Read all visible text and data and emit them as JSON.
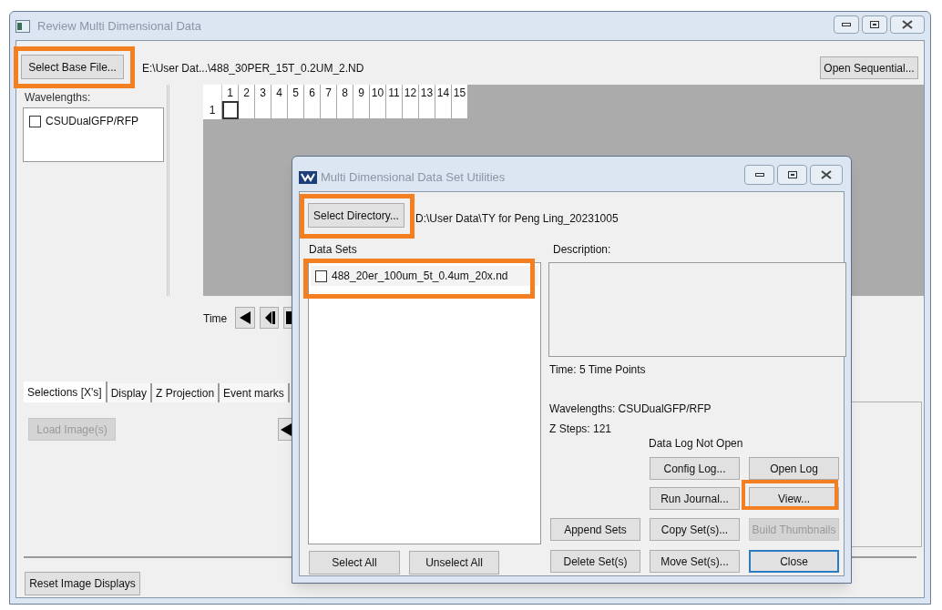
{
  "main_window": {
    "title": "Review Multi Dimensional Data",
    "base_file_button": {
      "label": "Select Base File...",
      "highlighted": true
    },
    "base_file_path": "E:\\User Dat...\\488_30PER_15T_0.2UM_2.ND",
    "open_sequential_button": "Open Sequential...",
    "wavelengths_label": "Wavelengths:",
    "wavelengths": [
      {
        "label": "CSUDualGFP/RFP",
        "checked": false
      }
    ],
    "grid": {
      "columns": [
        "1",
        "2",
        "3",
        "4",
        "5",
        "6",
        "7",
        "8",
        "9",
        "10",
        "11",
        "12",
        "13",
        "14",
        "15"
      ],
      "row": "1"
    },
    "time_label": "Time",
    "tabs": [
      {
        "label": "Selections [X's]",
        "selected": true
      },
      {
        "label": "Display",
        "selected": false
      },
      {
        "label": "Z Projection",
        "selected": false
      },
      {
        "label": "Event marks",
        "selected": false
      }
    ],
    "load_button": {
      "label": "Load Image(s)",
      "disabled": true
    },
    "reset_button": "Reset Image Displays"
  },
  "dialog": {
    "title": "Multi Dimensional Data Set Utilities",
    "directory_button": {
      "label": "Select Directory...",
      "highlighted": true
    },
    "directory_path": "D:\\User Data\\TY for Peng Ling_20231005",
    "data_sets_label": "Data Sets",
    "data_sets": [
      {
        "label": "488_20er_100um_5t_0.4um_20x.nd",
        "checked": false,
        "highlighted": true
      }
    ],
    "description_label": "Description:",
    "time_info": "Time: 5 Time Points",
    "wavelengths_info": "Wavelengths: CSUDualGFP/RFP",
    "z_steps_info": "Z Steps: 121",
    "log_status": "Data Log Not Open",
    "buttons": [
      {
        "label": "Config Log...",
        "disabled": false,
        "highlighted": false,
        "focused": false
      },
      {
        "label": "Open Log",
        "disabled": false,
        "highlighted": false,
        "focused": false
      },
      {
        "label": "Run Journal...",
        "disabled": false,
        "highlighted": false,
        "focused": false
      },
      {
        "label": "View...",
        "disabled": false,
        "highlighted": true,
        "focused": false
      },
      {
        "label": "Append Sets",
        "disabled": false,
        "highlighted": false,
        "focused": false
      },
      {
        "label": "Copy Set(s)...",
        "disabled": false,
        "highlighted": false,
        "focused": false
      },
      {
        "label": "Build Thumbnails",
        "disabled": true,
        "highlighted": false,
        "focused": false
      },
      {
        "label": "Delete Set(s)",
        "disabled": false,
        "highlighted": false,
        "focused": false
      },
      {
        "label": "Move Set(s)...",
        "disabled": false,
        "highlighted": false,
        "focused": false
      },
      {
        "label": "Close",
        "disabled": false,
        "highlighted": false,
        "focused": true
      }
    ],
    "select_all_button": "Select All",
    "unselect_all_button": "Unselect All"
  }
}
